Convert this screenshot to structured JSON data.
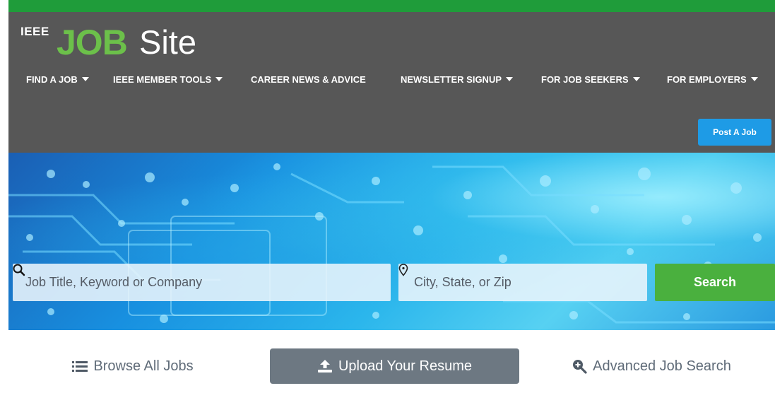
{
  "logo": {
    "prefix": "IEEE",
    "job": "JOB",
    "site": "Site"
  },
  "nav": [
    {
      "label": "FIND A JOB",
      "dropdown": true
    },
    {
      "label": "IEEE MEMBER TOOLS",
      "dropdown": true
    },
    {
      "label": "CAREER NEWS & ADVICE",
      "dropdown": false
    },
    {
      "label": "NEWSLETTER SIGNUP",
      "dropdown": true
    },
    {
      "label": "FOR JOB SEEKERS",
      "dropdown": true
    },
    {
      "label": "FOR EMPLOYERS",
      "dropdown": true
    }
  ],
  "post_job": {
    "label": "Post A Job"
  },
  "search": {
    "keyword_placeholder": "Job Title, Keyword or Company",
    "location_placeholder": "City, State, or Zip",
    "button_label": "Search",
    "keyword_icon": "search-icon",
    "location_icon": "location-pin-icon"
  },
  "actions": {
    "browse": {
      "label": "Browse All Jobs",
      "icon": "list-icon"
    },
    "upload": {
      "label": "Upload Your Resume",
      "icon": "upload-icon"
    },
    "advanced": {
      "label": "Advanced Job Search",
      "icon": "zoom-in-icon"
    }
  },
  "colors": {
    "top_bar": "#1f9c3a",
    "header_bg": "#575757",
    "logo_green": "#6cc04a",
    "post_button": "#1e9be6",
    "search_button": "#4ab03e",
    "upload_button": "#6d7882"
  }
}
